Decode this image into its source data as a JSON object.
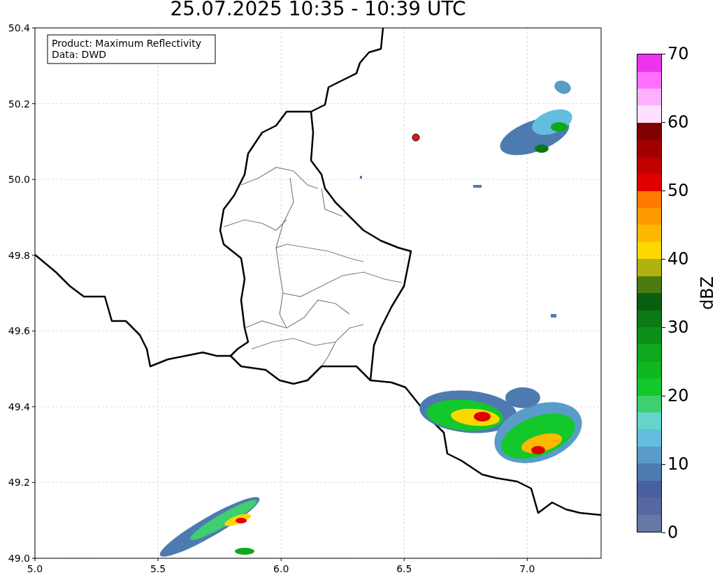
{
  "title": "25.07.2025 10:35 - 10:39 UTC",
  "map": {
    "legend": [
      "Product: Maximum Reflectivity",
      "Data: DWD"
    ],
    "xticks": [
      "5.0",
      "5.5",
      "6.0",
      "6.5",
      "7.0"
    ],
    "yticks": [
      "50.4",
      "50.2",
      "50.0",
      "49.8",
      "49.6",
      "49.4",
      "49.2",
      "49.0"
    ]
  },
  "colorbar": {
    "label": "dBZ",
    "ticks": [
      "70",
      "60",
      "50",
      "40",
      "30",
      "20",
      "10",
      "0"
    ],
    "segments": [
      {
        "color": "#6677a8"
      },
      {
        "color": "#5568a0"
      },
      {
        "color": "#4760a0"
      },
      {
        "color": "#4d7bb0"
      },
      {
        "color": "#5a9cc8"
      },
      {
        "color": "#62bedc"
      },
      {
        "color": "#64d5c8"
      },
      {
        "color": "#3ecf6e"
      },
      {
        "color": "#12c82a"
      },
      {
        "color": "#10b820"
      },
      {
        "color": "#0ea81c"
      },
      {
        "color": "#0a9018"
      },
      {
        "color": "#0a7a16"
      },
      {
        "color": "#0a5e10"
      },
      {
        "color": "#4a7a10"
      },
      {
        "color": "#b0b010"
      },
      {
        "color": "#ffd700"
      },
      {
        "color": "#ffb800"
      },
      {
        "color": "#ff9900"
      },
      {
        "color": "#ff7a00"
      },
      {
        "color": "#e00000"
      },
      {
        "color": "#c00000"
      },
      {
        "color": "#a00000"
      },
      {
        "color": "#800000"
      },
      {
        "color": "#ffe0ff"
      },
      {
        "color": "#ffb0ff"
      },
      {
        "color": "#ff70ff"
      },
      {
        "color": "#ee33ee"
      }
    ]
  }
}
